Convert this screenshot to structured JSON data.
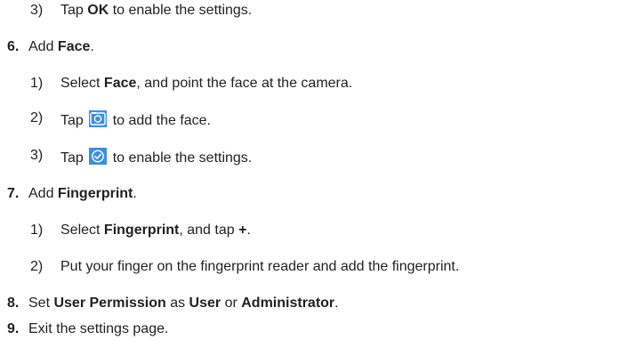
{
  "lines": {
    "l1": {
      "num": "3)",
      "pre": "Tap ",
      "b1": "OK",
      "post": " to enable the settings."
    },
    "l2": {
      "num": "6.",
      "pre": "Add ",
      "b1": "Face",
      "post": "."
    },
    "l3": {
      "num": "1)",
      "pre": "Select ",
      "b1": "Face",
      "post": ", and point the face at the camera."
    },
    "l4": {
      "num": "2)",
      "pre": "Tap ",
      "post": " to add the face.",
      "icon": "camera-icon"
    },
    "l5": {
      "num": "3)",
      "pre": "Tap ",
      "post": " to enable the settings.",
      "icon": "checkmark-icon"
    },
    "l6": {
      "num": "7.",
      "pre": "Add ",
      "b1": "Fingerprint",
      "post": "."
    },
    "l7": {
      "num": "1)",
      "pre": "Select ",
      "b1": "Fingerprint",
      "mid": ", and tap ",
      "b2": "+",
      "post": "."
    },
    "l8": {
      "num": "2)",
      "text": "Put your finger on the fingerprint reader and add the fingerprint."
    },
    "l9": {
      "num": "8.",
      "pre": "Set ",
      "b1": "User Permission",
      "mid1": " as ",
      "b2": "User",
      "mid2": " or ",
      "b3": "Administrator",
      "post": "."
    },
    "l10": {
      "num": "9.",
      "text": "Exit the settings page."
    }
  },
  "colors": {
    "text": "#231f20",
    "icon_blue": "#3d8fe0"
  }
}
